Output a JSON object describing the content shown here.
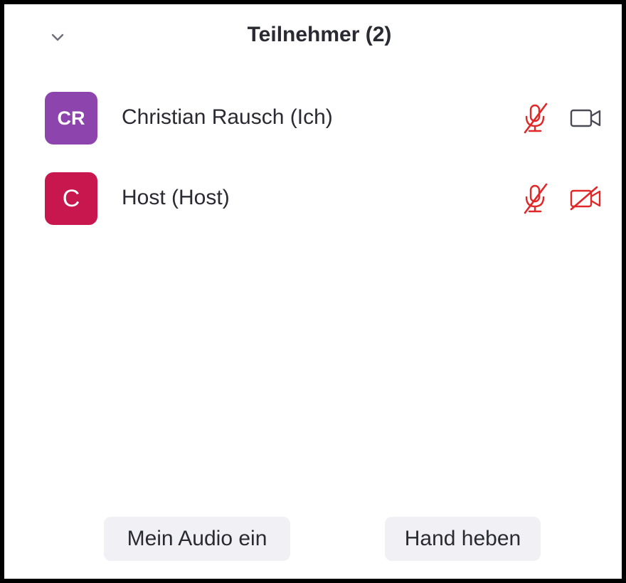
{
  "panel": {
    "title": "Teilnehmer (2)"
  },
  "colors": {
    "muted_red": "#e02828",
    "icon_gray": "#4a4a55",
    "avatar_cr": "#8d44ad",
    "avatar_c": "#c8174f"
  },
  "participants": [
    {
      "initials": "CR",
      "name": "Christian Rausch (Ich)",
      "mic_icon": "mic-muted-icon",
      "cam_icon": "video-camera-icon"
    },
    {
      "initials": "C",
      "name": "Host (Host)",
      "mic_icon": "mic-muted-icon",
      "cam_icon": "video-off-icon"
    }
  ],
  "footer": {
    "audio_label": "Mein Audio ein",
    "hand_label": "Hand heben"
  }
}
